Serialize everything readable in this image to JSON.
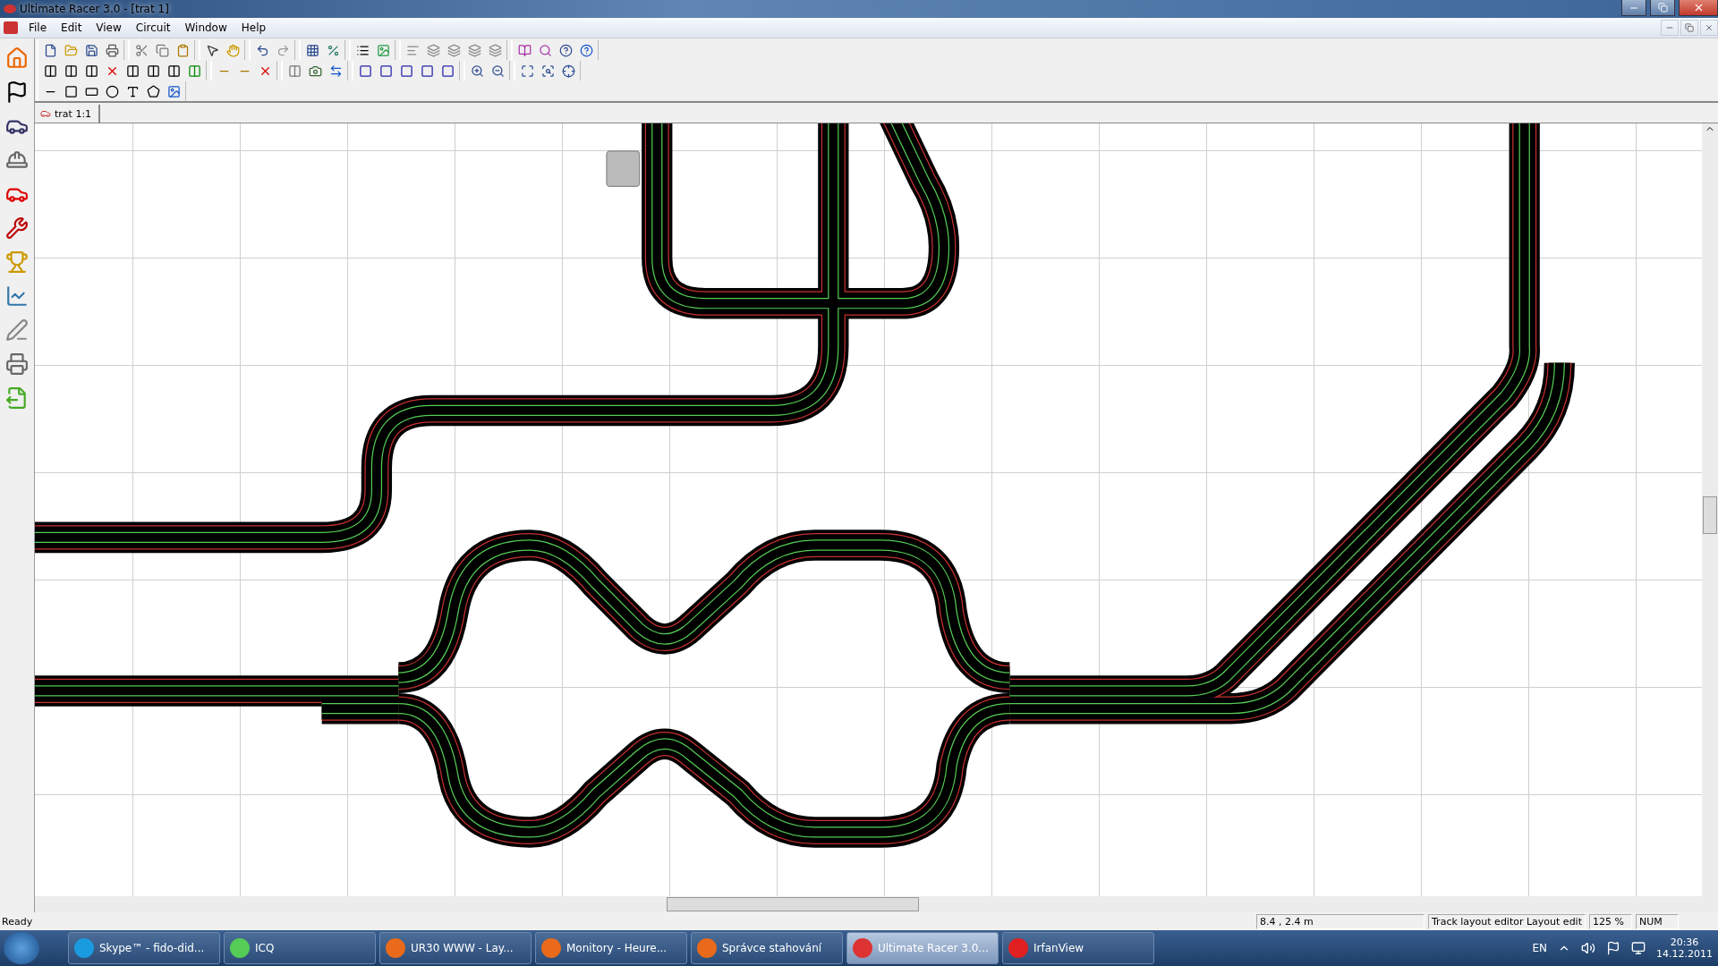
{
  "window": {
    "title": "Ultimate Racer 3.0 - [trat 1]"
  },
  "menu": [
    "File",
    "Edit",
    "View",
    "Circuit",
    "Window",
    "Help"
  ],
  "document_tab": {
    "label": "trat 1:1",
    "selected": true
  },
  "status_bar": {
    "message": "Ready",
    "panels": [
      "8.4 , 2.4 m",
      "Track layout editor Layout edit",
      "125 %",
      "NUM"
    ]
  },
  "taskbar": {
    "items": [
      {
        "label": "Skype™ - fido-did...",
        "kind": "skype",
        "selected": false
      },
      {
        "label": "ICQ",
        "kind": "icq",
        "selected": false
      },
      {
        "label": "UR30 WWW - Lay...",
        "kind": "firefox",
        "selected": false
      },
      {
        "label": "Monitory - Heure...",
        "kind": "firefox",
        "selected": false
      },
      {
        "label": "Správce stahování",
        "kind": "firefox",
        "selected": false
      },
      {
        "label": "Ultimate Racer 3.0...",
        "kind": "racer",
        "selected": true
      },
      {
        "label": "IrfanView",
        "kind": "irfan",
        "selected": false
      }
    ],
    "language": "EN",
    "time": "20:36",
    "date": "14.12.2011"
  }
}
